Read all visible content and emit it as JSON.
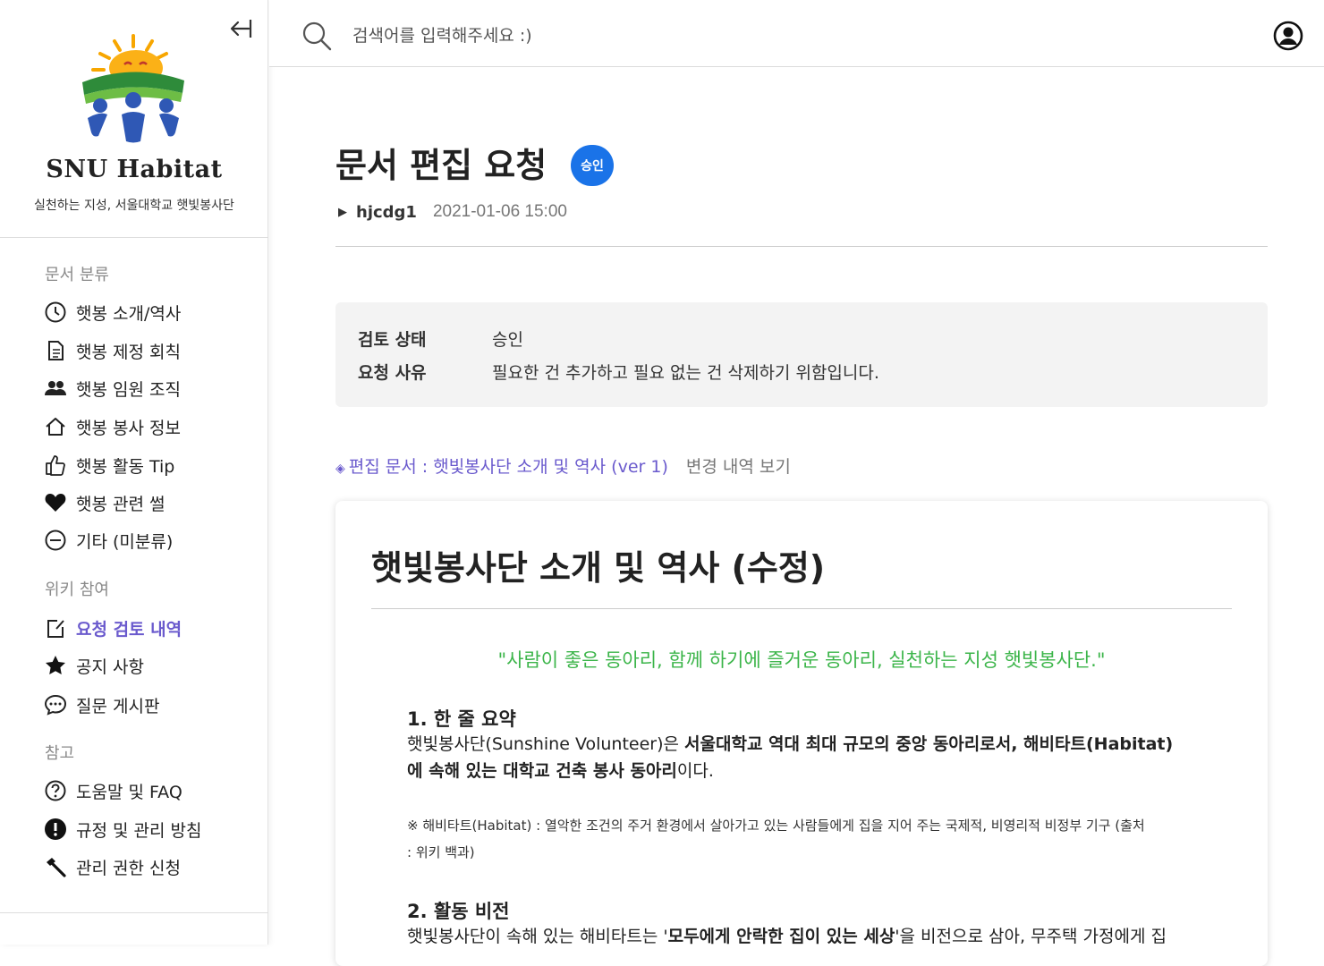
{
  "sidebar": {
    "brand": "SNU Habitat",
    "tagline": "실천하는 지성, 서울대학교 햇빛봉사단",
    "sections": [
      {
        "title": "문서 분류",
        "items": [
          {
            "label": "햇봉 소개/역사",
            "icon": "clock-icon"
          },
          {
            "label": "햇봉 제정 회칙",
            "icon": "document-icon"
          },
          {
            "label": "햇봉 임원 조직",
            "icon": "people-icon"
          },
          {
            "label": "햇봉 봉사 정보",
            "icon": "home-icon"
          },
          {
            "label": "햇봉 활동 Tip",
            "icon": "thumbs-up-icon"
          },
          {
            "label": "햇봉 관련 썰",
            "icon": "heart-icon"
          },
          {
            "label": "기타 (미분류)",
            "icon": "minus-circle-icon"
          }
        ]
      },
      {
        "title": "위키 참여",
        "items": [
          {
            "label": "요청 검토 내역",
            "icon": "edit-icon",
            "active": true
          },
          {
            "label": "공지 사항",
            "icon": "star-icon"
          },
          {
            "label": "질문 게시판",
            "icon": "chat-icon"
          }
        ]
      },
      {
        "title": "참고",
        "items": [
          {
            "label": "도움말 및 FAQ",
            "icon": "question-icon"
          },
          {
            "label": "규정 및 관리 방침",
            "icon": "alert-icon"
          },
          {
            "label": "관리 권한 신청",
            "icon": "hammer-icon"
          }
        ]
      }
    ]
  },
  "topbar": {
    "search_placeholder": "검색어를 입력해주세요 :)"
  },
  "request": {
    "title": "문서 편집 요청",
    "status_badge": "승인",
    "author": "hjcdg1",
    "datetime": "2021-01-06 15:00",
    "info": [
      {
        "key": "검토 상태",
        "value": "승인"
      },
      {
        "key": "요청 사유",
        "value": "필요한 건 추가하고 필요 없는 건 삭제하기 위함입니다."
      }
    ],
    "doc_link": "편집 문서 : 햇빛봉사단 소개 및 역사 (ver 1)",
    "history_link": "변경 내역 보기"
  },
  "document": {
    "title": "햇빛봉사단 소개 및 역사 (수정)",
    "quote": "\"사람이 좋은 동아리, 함께 하기에 즐거운 동아리, 실천하는 지성 햇빛봉사단.\"",
    "section1_heading": "1. 한 줄 요약",
    "section1_line1_a": "햇빛봉사단(Sunshine Volunteer)은 ",
    "section1_line1_b": "서울대학교 역대 최대 규모의 중앙 동아리로서, 해비타트(Habitat)",
    "section1_line2_a": "에 속해 있는 대학교 건축 봉사 동아리",
    "section1_line2_b": "이다.",
    "note_line1": "※ 해비타트(Habitat) : 열악한 조건의 주거 환경에서 살아가고 있는 사람들에게 집을 지어 주는 국제적, 비영리적 비정부 기구 (출처",
    "note_line2": ": 위키 백과)",
    "section2_heading": "2. 활동 비전",
    "section2_line1_a": "햇빛봉사단이 속해 있는 해비타트는 '",
    "section2_line1_b": "모두에게 안락한 집이 있는 세상",
    "section2_line1_c": "'을 비전으로 삼아, 무주택 가정에게 집"
  },
  "colors": {
    "accent": "#6a5acd",
    "badge": "#1a73e8",
    "quote": "#3cb54a"
  }
}
